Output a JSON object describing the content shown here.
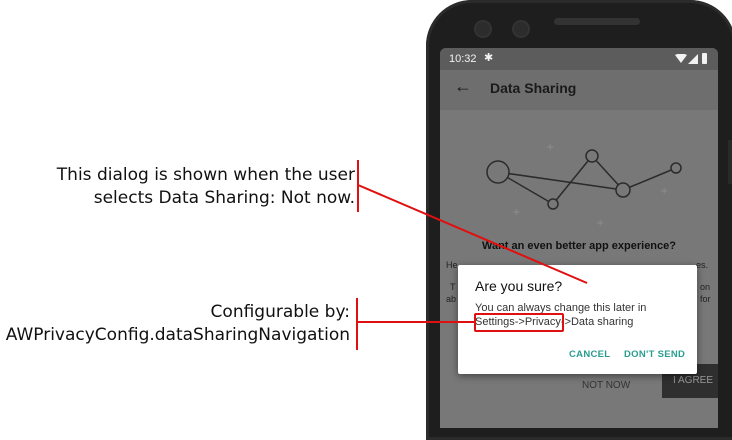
{
  "callouts": [
    {
      "line1": "This dialog is shown when the user",
      "line2": "selects Data Sharing: Not now."
    },
    {
      "line1": "Configurable by:",
      "line2": "AWPrivacyConfig.dataSharingNavigation"
    }
  ],
  "status_bar": {
    "time": "10:32",
    "settings_icon": "gear-icon",
    "wifi_icon": "wifi-icon",
    "signal_icon": "signal-icon",
    "battery_icon": "battery-icon"
  },
  "app_bar": {
    "back_icon": "arrow-left-icon",
    "title": "Data Sharing"
  },
  "background_screen": {
    "heading": "Want an even better app experience?",
    "body_fragments": [
      "He",
      "es.",
      "T",
      "on",
      "ab",
      "for"
    ],
    "not_now": "NOT NOW",
    "agree": "I AGREE"
  },
  "dialog": {
    "title": "Are you sure?",
    "message_line1": "You can always change this later in",
    "path_highlighted": "Settings->Privacy",
    "path_rest": "->Data sharing",
    "cancel": "CANCEL",
    "dont_send": "DON'T SEND"
  },
  "colors": {
    "accent": "#2a9d8f",
    "callout_red": "#e01010",
    "scrim": "#757575"
  }
}
